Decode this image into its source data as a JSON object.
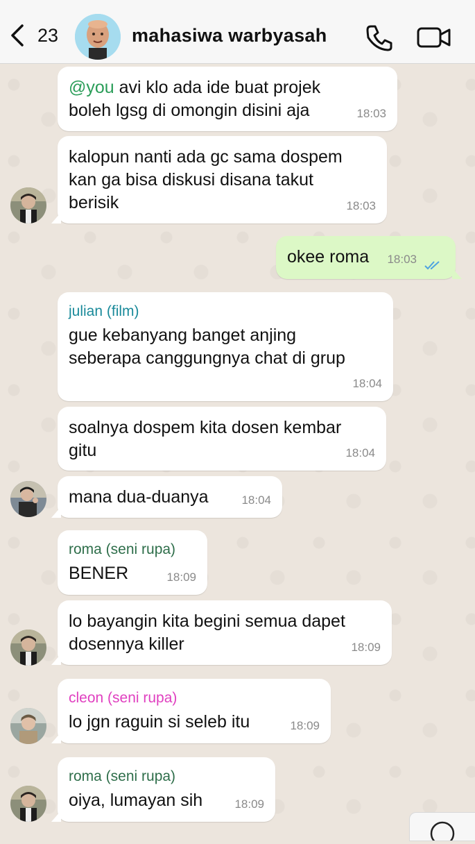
{
  "header": {
    "back_count": "23",
    "title": "mahasiwa warbyasah"
  },
  "messages": [
    {
      "mention": "@you",
      "text": " avi klo ada ide buat projek\nboleh lgsg di omongin disini aja",
      "time": "18:03"
    },
    {
      "text": "kalopun nanti ada gc sama dospem\nkan ga bisa diskusi disana takut\nberisik",
      "time": "18:03"
    },
    {
      "text": "okee roma",
      "time": "18:03"
    },
    {
      "sender": "julian (film)",
      "text": "gue kebanyang banget anjing\nseberapa canggungnya chat di grup",
      "time": "18:04"
    },
    {
      "text": "soalnya dospem kita dosen kembar\ngitu",
      "time": "18:04"
    },
    {
      "text": "mana dua-duanya",
      "time": "18:04"
    },
    {
      "sender": "roma (seni rupa)",
      "text": "BENER",
      "time": "18:09"
    },
    {
      "text": "lo bayangin kita begini semua dapet\ndosennya killer",
      "time": "18:09"
    },
    {
      "sender": "cleon (seni rupa)",
      "text": "lo jgn raguin si seleb itu",
      "time": "18:09"
    },
    {
      "sender": "roma (seni rupa)",
      "text": "oiya, lumayan sih",
      "time": "18:09"
    }
  ],
  "colors": {
    "julian": "#1a8a9a",
    "roma": "#2e6e4a",
    "cleon": "#e040c0",
    "outgoing_bubble": "#dcf8c6",
    "read_ticks": "#4fa3e0"
  }
}
